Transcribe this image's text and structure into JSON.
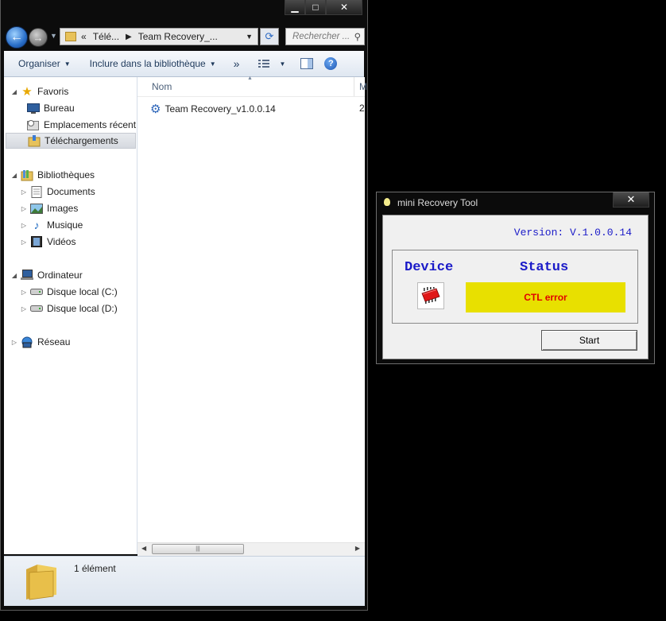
{
  "explorer": {
    "breadcrumb": {
      "prefix": "«",
      "parent": "Télé...",
      "current": "Team Recovery_..."
    },
    "search_placeholder": "Rechercher ...",
    "toolbar": {
      "organize": "Organiser",
      "include": "Inclure dans la bibliothèque",
      "more": "»"
    },
    "nav": {
      "favorites": "Favoris",
      "desktop": "Bureau",
      "recent": "Emplacements récent",
      "downloads": "Téléchargements",
      "libraries": "Bibliothèques",
      "documents": "Documents",
      "images": "Images",
      "music": "Musique",
      "videos": "Vidéos",
      "computer": "Ordinateur",
      "disk_c": "Disque local (C:)",
      "disk_d": "Disque local (D:)",
      "network": "Réseau"
    },
    "columns": {
      "name": "Nom",
      "next": "M"
    },
    "files": [
      {
        "name": "Team Recovery_v1.0.0.14",
        "col2": "2"
      }
    ],
    "status": "1 élément"
  },
  "tool": {
    "title": "mini Recovery Tool",
    "version": "Version: V.1.0.0.14",
    "device_label": "Device",
    "status_label": "Status",
    "status_value": "CTL error",
    "start_label": "Start"
  },
  "colors": {
    "accent_blue": "#1a1ac8",
    "status_bg": "#e8e000",
    "status_text": "#e00000"
  }
}
